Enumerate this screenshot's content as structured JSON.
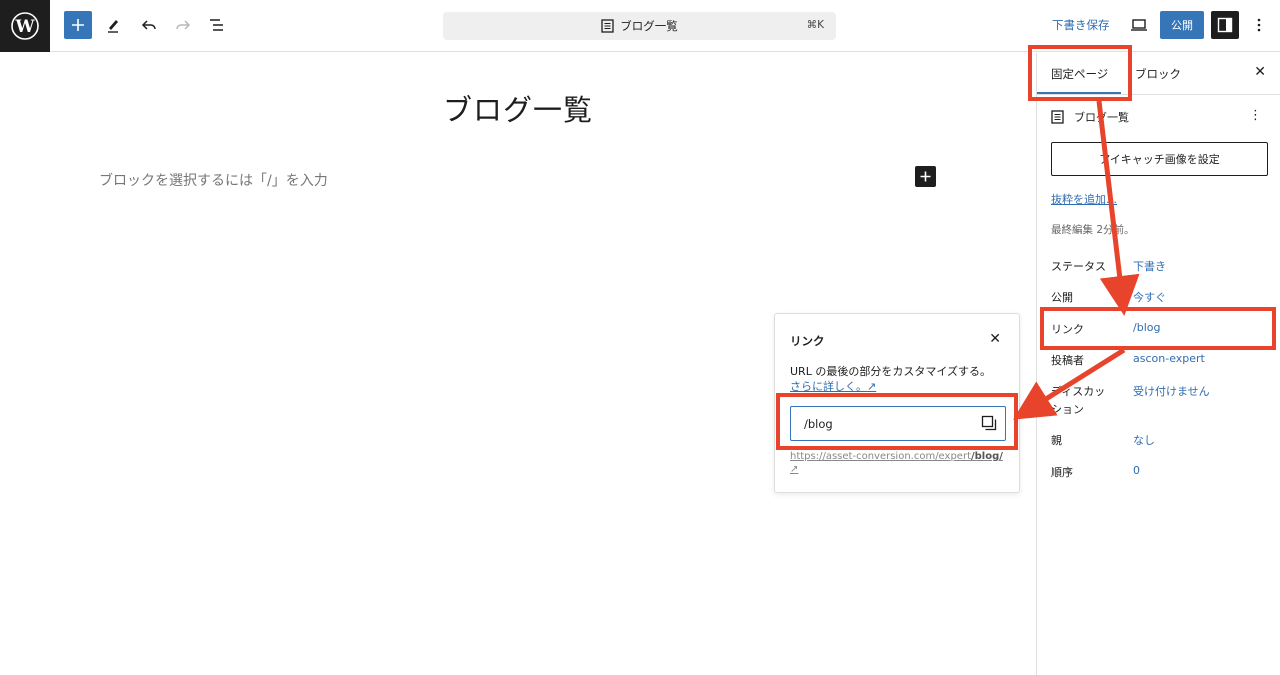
{
  "topbar": {
    "logo": "wordpress-logo",
    "tools": [
      "add-block",
      "pencil",
      "undo",
      "redo",
      "list-view"
    ],
    "doc_title": "ブログ一覧",
    "shortcut": "⌘K",
    "save_draft": "下書き保存",
    "publish": "公開"
  },
  "editor": {
    "title": "ブログ一覧",
    "placeholder": "ブロックを選択するには「/」を入力"
  },
  "sidebar": {
    "tabs": [
      "固定ページ",
      "ブロック"
    ],
    "active_tab": "固定ページ",
    "doc_title": "ブログ一覧",
    "featured_image_button": "アイキャッチ画像を設定",
    "excerpt_link": "抜粋を追加…",
    "last_edited": "最終編集 2分前。",
    "properties": [
      {
        "key": "ステータス",
        "value": "下書き"
      },
      {
        "key": "公開",
        "value": "今すぐ"
      },
      {
        "key": "リンク",
        "value": "/blog"
      },
      {
        "key": "投稿者",
        "value": "ascon-expert"
      },
      {
        "key": "ディスカッション",
        "value": "受け付けません"
      },
      {
        "key": "親",
        "value": "なし"
      },
      {
        "key": "順序",
        "value": "0"
      }
    ]
  },
  "popover": {
    "title": "リンク",
    "description": "URL の最後の部分をカスタマイズする。",
    "learn_more": "さらに詳しく。↗",
    "slug_value": "/blog",
    "url_prefix": "https://asset-conversion.com/expert",
    "url_slug": "/blog/",
    "url_suffix": "↗"
  },
  "colors": {
    "accent": "#3676b8",
    "annotation": "#e8442c",
    "dark": "#1e1e1e"
  }
}
